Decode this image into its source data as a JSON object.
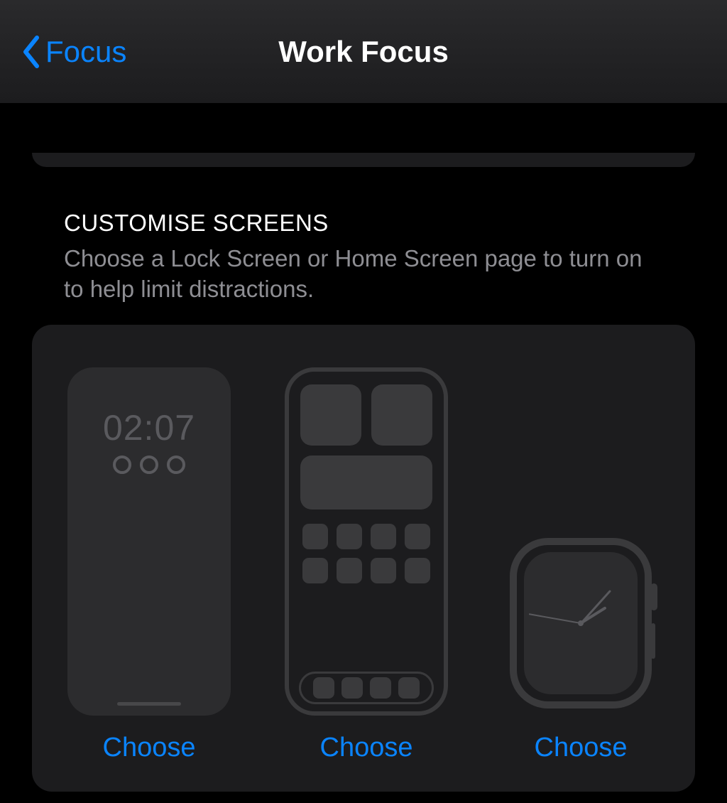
{
  "nav": {
    "back_label": "Focus",
    "title": "Work Focus"
  },
  "section": {
    "title": "CUSTOMISE SCREENS",
    "subtitle": "Choose a Lock Screen or Home Screen page to turn on to help limit distractions."
  },
  "lock_screen": {
    "time": "02:07",
    "choose_label": "Choose"
  },
  "home_screen": {
    "choose_label": "Choose"
  },
  "watch": {
    "choose_label": "Choose"
  }
}
